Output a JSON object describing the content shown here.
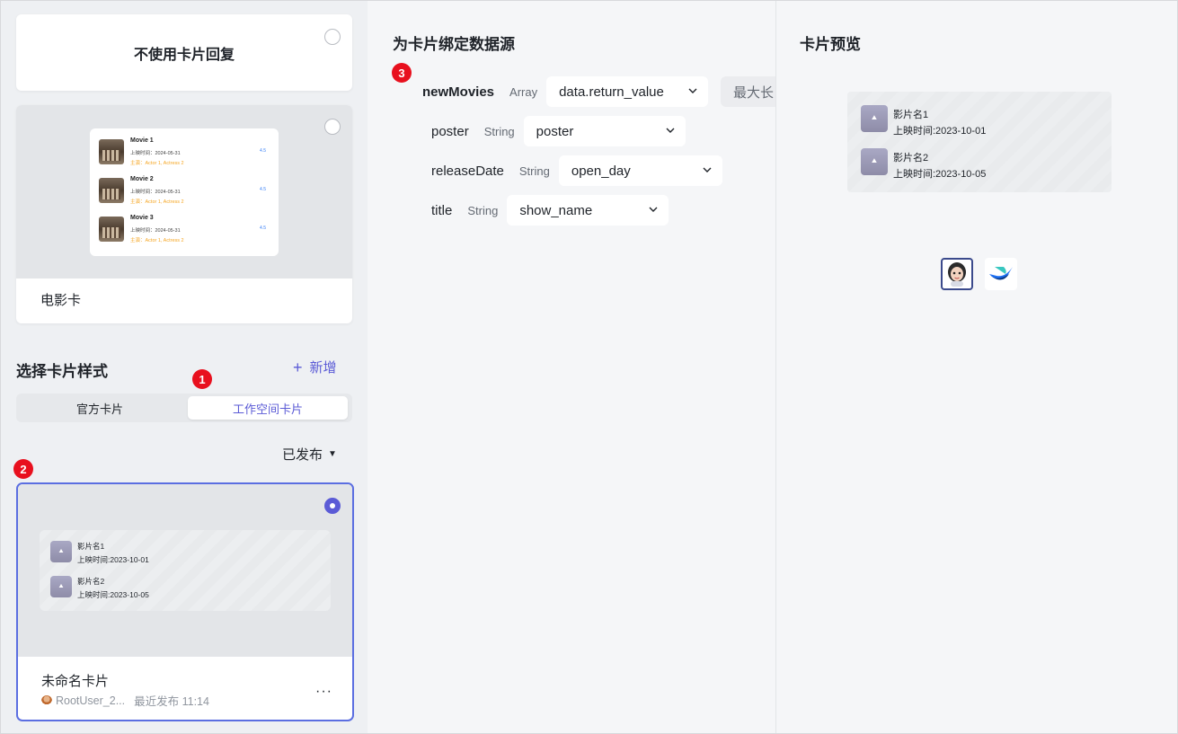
{
  "left": {
    "card_none_label": "不使用卡片回复",
    "movie_card": {
      "name": "电影卡",
      "movies": [
        {
          "title": "Movie 1",
          "date": "上映时间：2024-05-31",
          "actors": "主演：Actor 1, Actress 2",
          "score": "4.5"
        },
        {
          "title": "Movie 2",
          "date": "上映时间：2024-05-31",
          "actors": "主演：Actor 1, Actress 2",
          "score": "4.5"
        },
        {
          "title": "Movie 3",
          "date": "上映时间：2024-05-31",
          "actors": "主演：Actor 1, Actress 2",
          "score": "4.5"
        }
      ]
    },
    "section_title": "选择卡片样式",
    "add_label": "新增",
    "add_icon": "+",
    "tabs": [
      "官方卡片",
      "工作空间卡片"
    ],
    "active_tab": "工作空间卡片",
    "filter_label": "已发布",
    "filter_icon": "▼",
    "selected_card": {
      "name": "未命名卡片",
      "author": "RootUser_2...",
      "published": "最近发布 11:14",
      "more": "···",
      "items": [
        {
          "title": "影片名1",
          "date": "上映时间:2023-10-01"
        },
        {
          "title": "影片名2",
          "date": "上映时间:2023-10-05"
        }
      ]
    }
  },
  "badges": [
    "1",
    "2",
    "3"
  ],
  "middle": {
    "title": "为卡片绑定数据源",
    "root": {
      "name": "newMovies",
      "type": "Array",
      "value": "data.return_value",
      "extra": "最大长"
    },
    "fields": [
      {
        "name": "poster",
        "type": "String",
        "value": "poster"
      },
      {
        "name": "releaseDate",
        "type": "String",
        "value": "open_day"
      },
      {
        "name": "title",
        "type": "String",
        "value": "show_name"
      }
    ]
  },
  "right": {
    "title": "卡片预览",
    "items": [
      {
        "title": "影片名1",
        "date": "上映时间:2023-10-01"
      },
      {
        "title": "影片名2",
        "date": "上映时间:2023-10-05"
      }
    ],
    "platform_icons": [
      "avatar-icon",
      "bird-logo-icon"
    ]
  },
  "colors": {
    "accent": "#5b5bd6",
    "badge": "#e8101e",
    "selected_border": "#5b6ee1"
  }
}
